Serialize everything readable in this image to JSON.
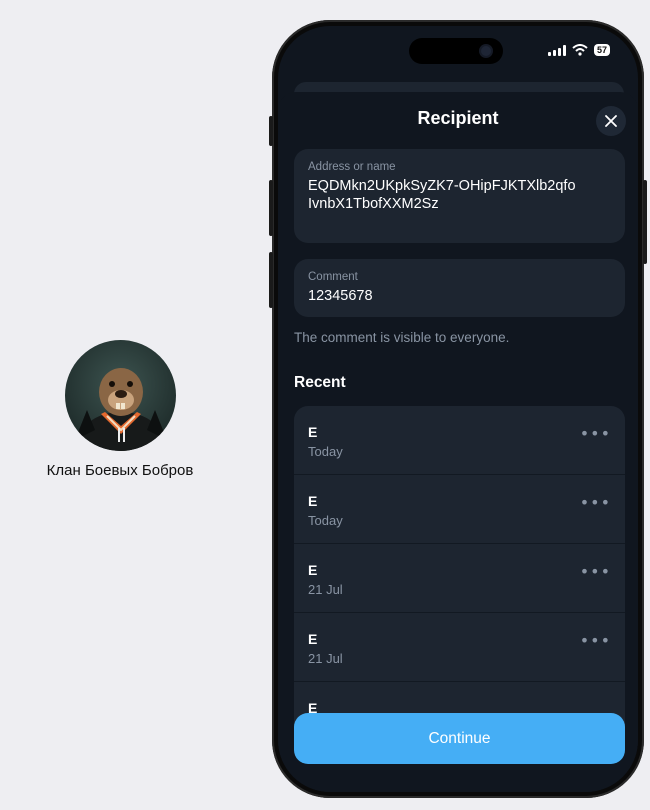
{
  "profile": {
    "name": "Клан Боевых Бобров"
  },
  "status_bar": {
    "battery": "57"
  },
  "sheet": {
    "title": "Recipient"
  },
  "address_field": {
    "label": "Address or name",
    "value": "EQDMkn2UKpkSyZK7-OHipFJKTXlb2qfoIvnbX1TbofXXM2Sz"
  },
  "comment_field": {
    "label": "Comment",
    "value": "12345678"
  },
  "comment_hint": "The comment is visible to everyone.",
  "recent": {
    "heading": "Recent",
    "items": [
      {
        "name": "E",
        "date": "Today"
      },
      {
        "name": "E",
        "date": "Today"
      },
      {
        "name": "E",
        "date": "21 Jul"
      },
      {
        "name": "E",
        "date": "21 Jul"
      },
      {
        "name": "E",
        "date": ""
      }
    ],
    "more_icon": "ellipsis-icon"
  },
  "continue_label": "Continue",
  "colors": {
    "accent": "#45aef5",
    "background": "#10161f",
    "card": "#1d2530",
    "secondary_text": "#8994a3"
  }
}
